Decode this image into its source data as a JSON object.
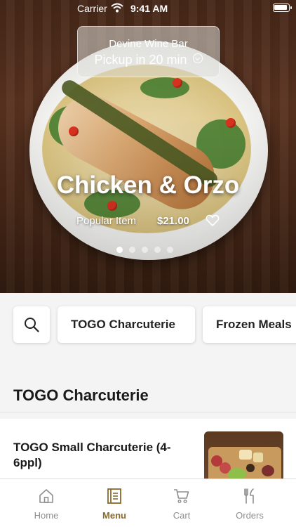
{
  "status_bar": {
    "carrier": "Carrier",
    "time": "9:41 AM"
  },
  "location": {
    "name": "Devine Wine Bar",
    "pickup": "Pickup in 20 min"
  },
  "hero": {
    "title": "Chicken & Orzo",
    "tag": "Popular Item",
    "price": "$21.00",
    "slides_total": 5,
    "slide_active": 1
  },
  "categories": {
    "search_icon": "search-icon",
    "chips": [
      "TOGO Charcuterie",
      "Frozen Meals"
    ]
  },
  "section": {
    "title": "TOGO Charcuterie",
    "items": [
      {
        "name": "TOGO Small Charcuterie (4-6ppl)"
      }
    ]
  },
  "tabbar": {
    "tabs": [
      {
        "label": "Home",
        "icon": "home-icon"
      },
      {
        "label": "Menu",
        "icon": "menu-icon"
      },
      {
        "label": "Cart",
        "icon": "cart-icon"
      },
      {
        "label": "Orders",
        "icon": "orders-icon"
      }
    ],
    "active": "Menu"
  },
  "colors": {
    "accent": "#8a6a28",
    "inactive": "#8e8e8e",
    "background": "#f4f4f4"
  }
}
